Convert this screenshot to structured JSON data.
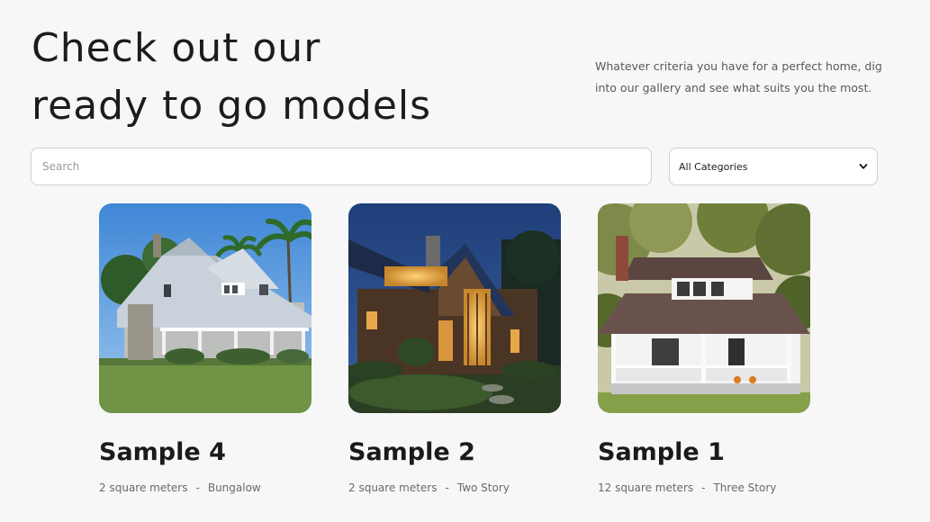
{
  "hero": {
    "title_line1": "Check out our",
    "title_line2": "ready to go models",
    "description": "Whatever criteria you have for a perfect home, dig into our gallery and see what suits you the most."
  },
  "filters": {
    "search_placeholder": "Search",
    "category_selected": "All Categories"
  },
  "models": [
    {
      "name": "Sample 4",
      "area": "2 square meters",
      "separator": "-",
      "type": "Bungalow"
    },
    {
      "name": "Sample 2",
      "area": "2 square meters",
      "separator": "-",
      "type": "Two Story"
    },
    {
      "name": "Sample 1",
      "area": "12 square meters",
      "separator": "-",
      "type": "Three Story"
    }
  ]
}
